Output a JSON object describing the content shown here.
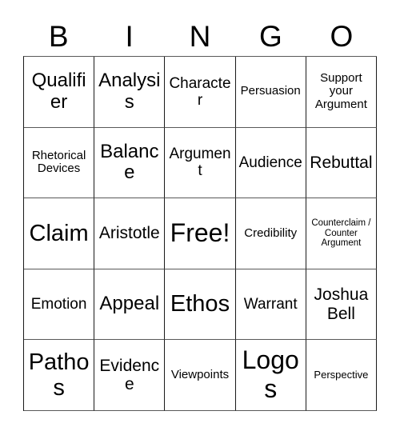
{
  "card": {
    "title": "BINGO Card",
    "header_letters": [
      "B",
      "I",
      "N",
      "G",
      "O"
    ],
    "background_color": "#ffffff",
    "text_color": "#000000",
    "border_color": "#1a1a1a",
    "rows": 5,
    "columns": 5,
    "cells": [
      [
        {
          "text": "Qualifier",
          "size": "lg"
        },
        {
          "text": "Analysis",
          "size": "lg"
        },
        {
          "text": "Character",
          "size": "sm"
        },
        {
          "text": "Persuasion",
          "size": "xs"
        },
        {
          "text": "Support your Argument",
          "size": "xs"
        }
      ],
      [
        {
          "text": "Rhetorical Devices",
          "size": "xs"
        },
        {
          "text": "Balance",
          "size": "lg"
        },
        {
          "text": "Argument",
          "size": "sm"
        },
        {
          "text": "Audience",
          "size": "sm"
        },
        {
          "text": "Rebuttal",
          "size": "md"
        }
      ],
      [
        {
          "text": "Claim",
          "size": "xl"
        },
        {
          "text": "Aristotle",
          "size": "md"
        },
        {
          "text": "Free!",
          "size": "xxl"
        },
        {
          "text": "Credibility",
          "size": "xs"
        },
        {
          "text": "Counterclaim / Counter Argument",
          "size": "tiny"
        }
      ],
      [
        {
          "text": "Emotion",
          "size": "sm"
        },
        {
          "text": "Appeal",
          "size": "lg"
        },
        {
          "text": "Ethos",
          "size": "xl"
        },
        {
          "text": "Warrant",
          "size": "sm"
        },
        {
          "text": "Joshua Bell",
          "size": "md"
        }
      ],
      [
        {
          "text": "Pathos",
          "size": "xl"
        },
        {
          "text": "Evidence",
          "size": "md"
        },
        {
          "text": "Viewpoints",
          "size": "xs"
        },
        {
          "text": "Logos",
          "size": "xxl"
        },
        {
          "text": "Perspective",
          "size": "xxs"
        }
      ]
    ]
  }
}
